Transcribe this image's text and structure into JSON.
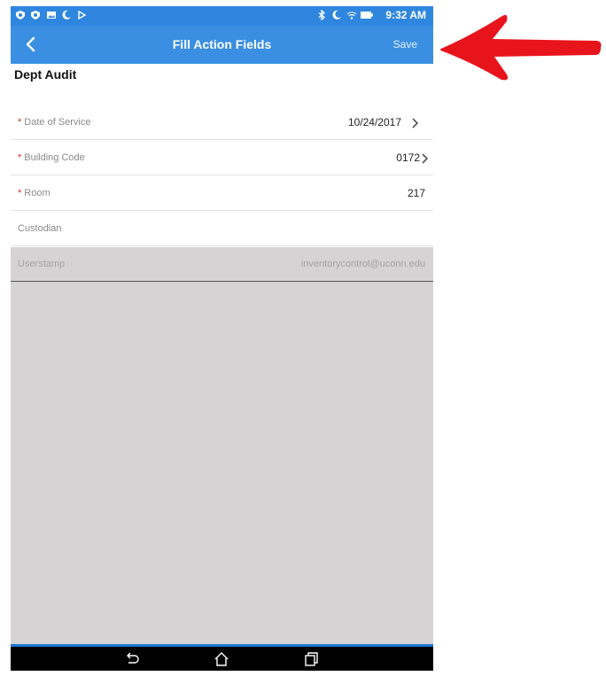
{
  "status_bar": {
    "time": "9:32 AM",
    "left_icons": [
      "shield-icon",
      "shield-icon",
      "image-icon",
      "moon-icon",
      "play-icon"
    ],
    "right_icons": [
      "bluetooth-icon",
      "moon-icon",
      "wifi-icon",
      "battery-icon"
    ]
  },
  "app_bar": {
    "title": "Fill Action Fields",
    "save_label": "Save",
    "back_icon": "chevron-left-icon",
    "color": "#3a8fe3"
  },
  "form": {
    "title": "Dept Audit",
    "fields": [
      {
        "label": "Date of Service",
        "required": true,
        "value": "10/24/2017",
        "has_chevron": true
      },
      {
        "label": "Building Code",
        "required": true,
        "value": "0172",
        "has_chevron": true
      },
      {
        "label": "Room",
        "required": true,
        "value": "217",
        "has_chevron": false
      },
      {
        "label": "Custodian",
        "required": false,
        "value": "",
        "has_chevron": false
      },
      {
        "label": "Userstamp",
        "required": false,
        "value": "inventorycontrol@uconn.edu",
        "has_chevron": false,
        "disabled": true
      }
    ],
    "required_marker": "*"
  },
  "nav_bar": {
    "icons": [
      "back-nav-icon",
      "home-icon",
      "recent-apps-icon"
    ]
  },
  "annotation": {
    "arrow_color": "#e8141b"
  }
}
